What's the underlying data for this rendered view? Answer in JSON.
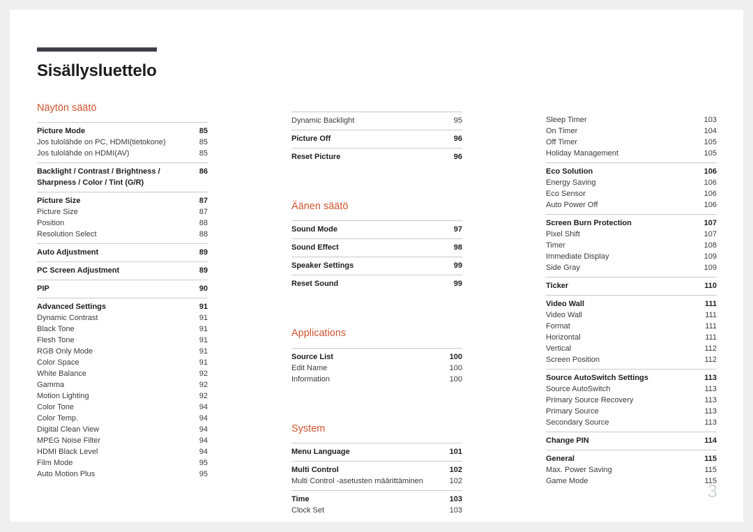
{
  "document": {
    "title": "Sisällysluettelo",
    "page_number": "3",
    "accent_color": "#cf5430",
    "rule_color": "#403e4b"
  },
  "columns": [
    {
      "name": "column-1",
      "sections": [
        {
          "heading": "Näytön säätö",
          "groups": [
            {
              "rows": [
                {
                  "label": "Picture Mode",
                  "page": "85",
                  "bold": true
                },
                {
                  "label": "Jos tulolähde on PC, HDMI(tietokone)",
                  "page": "85",
                  "bold": false
                },
                {
                  "label": "Jos tulolähde on HDMI(AV)",
                  "page": "85",
                  "bold": false
                }
              ]
            },
            {
              "rows": [
                {
                  "label": "Backlight / Contrast / Brightness / Sharpness / Color / Tint (G/R)",
                  "page": "86",
                  "bold": true,
                  "wrap": true
                }
              ]
            },
            {
              "rows": [
                {
                  "label": "Picture Size",
                  "page": "87",
                  "bold": true
                },
                {
                  "label": "Picture Size",
                  "page": "87",
                  "bold": false
                },
                {
                  "label": "Position",
                  "page": "88",
                  "bold": false
                },
                {
                  "label": "Resolution Select",
                  "page": "88",
                  "bold": false
                }
              ]
            },
            {
              "rows": [
                {
                  "label": "Auto Adjustment",
                  "page": "89",
                  "bold": true
                }
              ]
            },
            {
              "rows": [
                {
                  "label": "PC Screen Adjustment",
                  "page": "89",
                  "bold": true
                }
              ]
            },
            {
              "rows": [
                {
                  "label": "PIP",
                  "page": "90",
                  "bold": true
                }
              ]
            },
            {
              "rows": [
                {
                  "label": "Advanced Settings",
                  "page": "91",
                  "bold": true
                },
                {
                  "label": "Dynamic Contrast",
                  "page": "91",
                  "bold": false
                },
                {
                  "label": "Black Tone",
                  "page": "91",
                  "bold": false
                },
                {
                  "label": "Flesh Tone",
                  "page": "91",
                  "bold": false
                },
                {
                  "label": "RGB Only Mode",
                  "page": "91",
                  "bold": false
                },
                {
                  "label": "Color Space",
                  "page": "91",
                  "bold": false
                },
                {
                  "label": "White Balance",
                  "page": "92",
                  "bold": false
                },
                {
                  "label": "Gamma",
                  "page": "92",
                  "bold": false
                },
                {
                  "label": "Motion Lighting",
                  "page": "92",
                  "bold": false
                },
                {
                  "label": "Color Tone",
                  "page": "94",
                  "bold": false
                },
                {
                  "label": "Color Temp.",
                  "page": "94",
                  "bold": false
                },
                {
                  "label": "Digital Clean View",
                  "page": "94",
                  "bold": false
                },
                {
                  "label": "MPEG Noise Filter",
                  "page": "94",
                  "bold": false
                },
                {
                  "label": "HDMI Black Level",
                  "page": "94",
                  "bold": false
                },
                {
                  "label": "Film Mode",
                  "page": "95",
                  "bold": false
                },
                {
                  "label": "Auto Motion Plus",
                  "page": "95",
                  "bold": false
                }
              ]
            }
          ]
        }
      ]
    },
    {
      "name": "column-2",
      "sections": [
        {
          "heading": null,
          "groups": [
            {
              "rows": [
                {
                  "label": "Dynamic Backlight",
                  "page": "95",
                  "bold": false
                }
              ]
            },
            {
              "rows": [
                {
                  "label": "Picture Off",
                  "page": "96",
                  "bold": true
                }
              ]
            },
            {
              "rows": [
                {
                  "label": "Reset Picture",
                  "page": "96",
                  "bold": true
                }
              ]
            }
          ]
        },
        {
          "heading": "Äänen säätö",
          "groups": [
            {
              "rows": [
                {
                  "label": "Sound Mode",
                  "page": "97",
                  "bold": true
                }
              ]
            },
            {
              "rows": [
                {
                  "label": "Sound Effect",
                  "page": "98",
                  "bold": true
                }
              ]
            },
            {
              "rows": [
                {
                  "label": "Speaker Settings",
                  "page": "99",
                  "bold": true
                }
              ]
            },
            {
              "rows": [
                {
                  "label": "Reset Sound",
                  "page": "99",
                  "bold": true
                }
              ]
            }
          ]
        },
        {
          "heading": "Applications",
          "groups": [
            {
              "rows": [
                {
                  "label": "Source List",
                  "page": "100",
                  "bold": true
                },
                {
                  "label": "Edit Name",
                  "page": "100",
                  "bold": false
                },
                {
                  "label": "Information",
                  "page": "100",
                  "bold": false
                }
              ]
            }
          ]
        },
        {
          "heading": "System",
          "groups": [
            {
              "rows": [
                {
                  "label": "Menu Language",
                  "page": "101",
                  "bold": true
                }
              ]
            },
            {
              "rows": [
                {
                  "label": "Multi Control",
                  "page": "102",
                  "bold": true
                },
                {
                  "label": "Multi Control -asetusten määrittäminen",
                  "page": "102",
                  "bold": false
                }
              ]
            },
            {
              "rows": [
                {
                  "label": "Time",
                  "page": "103",
                  "bold": true
                },
                {
                  "label": "Clock Set",
                  "page": "103",
                  "bold": false
                }
              ]
            }
          ]
        }
      ]
    },
    {
      "name": "column-3",
      "sections": [
        {
          "heading": null,
          "groups": [
            {
              "no_rule": true,
              "rows": [
                {
                  "label": "Sleep Timer",
                  "page": "103",
                  "bold": false
                },
                {
                  "label": "On Timer",
                  "page": "104",
                  "bold": false
                },
                {
                  "label": "Off Timer",
                  "page": "105",
                  "bold": false
                },
                {
                  "label": "Holiday Management",
                  "page": "105",
                  "bold": false
                }
              ]
            },
            {
              "rows": [
                {
                  "label": "Eco Solution",
                  "page": "106",
                  "bold": true
                },
                {
                  "label": "Energy Saving",
                  "page": "106",
                  "bold": false
                },
                {
                  "label": "Eco Sensor",
                  "page": "106",
                  "bold": false
                },
                {
                  "label": "Auto Power Off",
                  "page": "106",
                  "bold": false
                }
              ]
            },
            {
              "rows": [
                {
                  "label": "Screen Burn Protection",
                  "page": "107",
                  "bold": true
                },
                {
                  "label": "Pixel Shift",
                  "page": "107",
                  "bold": false
                },
                {
                  "label": "Timer",
                  "page": "108",
                  "bold": false
                },
                {
                  "label": "Immediate Display",
                  "page": "109",
                  "bold": false
                },
                {
                  "label": "Side Gray",
                  "page": "109",
                  "bold": false
                }
              ]
            },
            {
              "rows": [
                {
                  "label": "Ticker",
                  "page": "110",
                  "bold": true
                }
              ]
            },
            {
              "rows": [
                {
                  "label": "Video Wall",
                  "page": "111",
                  "bold": true
                },
                {
                  "label": "Video Wall",
                  "page": "111",
                  "bold": false
                },
                {
                  "label": "Format",
                  "page": "111",
                  "bold": false
                },
                {
                  "label": "Horizontal",
                  "page": "111",
                  "bold": false
                },
                {
                  "label": "Vertical",
                  "page": "112",
                  "bold": false
                },
                {
                  "label": "Screen Position",
                  "page": "112",
                  "bold": false
                }
              ]
            },
            {
              "rows": [
                {
                  "label": "Source AutoSwitch Settings",
                  "page": "113",
                  "bold": true
                },
                {
                  "label": "Source AutoSwitch",
                  "page": "113",
                  "bold": false
                },
                {
                  "label": "Primary Source Recovery",
                  "page": "113",
                  "bold": false
                },
                {
                  "label": "Primary Source",
                  "page": "113",
                  "bold": false
                },
                {
                  "label": "Secondary Source",
                  "page": "113",
                  "bold": false
                }
              ]
            },
            {
              "rows": [
                {
                  "label": "Change PIN",
                  "page": "114",
                  "bold": true
                }
              ]
            },
            {
              "rows": [
                {
                  "label": "General",
                  "page": "115",
                  "bold": true
                },
                {
                  "label": "Max. Power Saving",
                  "page": "115",
                  "bold": false
                },
                {
                  "label": "Game Mode",
                  "page": "115",
                  "bold": false
                }
              ]
            }
          ]
        }
      ]
    }
  ]
}
